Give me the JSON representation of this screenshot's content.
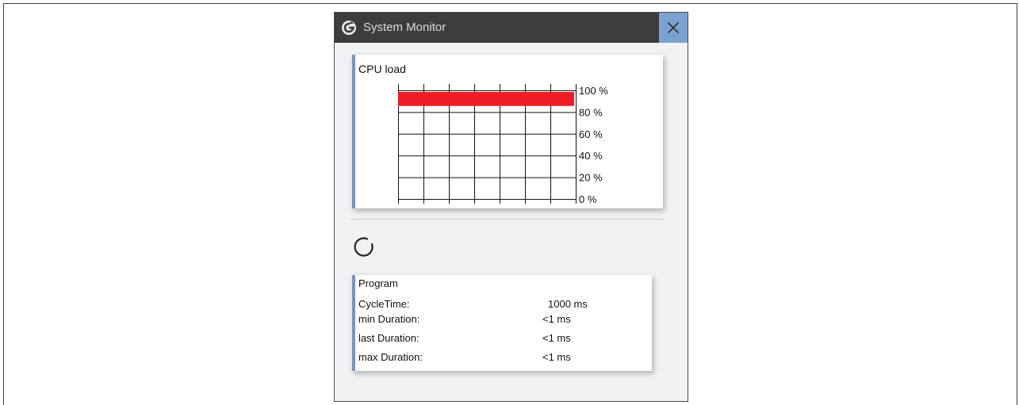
{
  "window": {
    "title": "System Monitor",
    "titlebar_color": "#3d3d3d",
    "close_button_color": "#7aa3d2"
  },
  "cpu": {
    "title": "CPU load",
    "bar_color": "#ee1c25",
    "load_fraction": 0.9,
    "y_ticks": [
      "100 %",
      "80 %",
      "60 %",
      "40 %",
      "20 %",
      "0 %"
    ]
  },
  "program": {
    "title": "Program",
    "rows": [
      {
        "label": "CycleTime:",
        "value": "1000 ms"
      },
      {
        "label": "min Duration:",
        "value": "<1 ms"
      },
      {
        "label": "last Duration:",
        "value": "<1 ms"
      },
      {
        "label": "max Duration:",
        "value": "<1 ms"
      }
    ]
  },
  "icons": {
    "app": "circular-arrow-app-icon",
    "close": "close-icon",
    "spinner": "loading-spinner-icon"
  }
}
